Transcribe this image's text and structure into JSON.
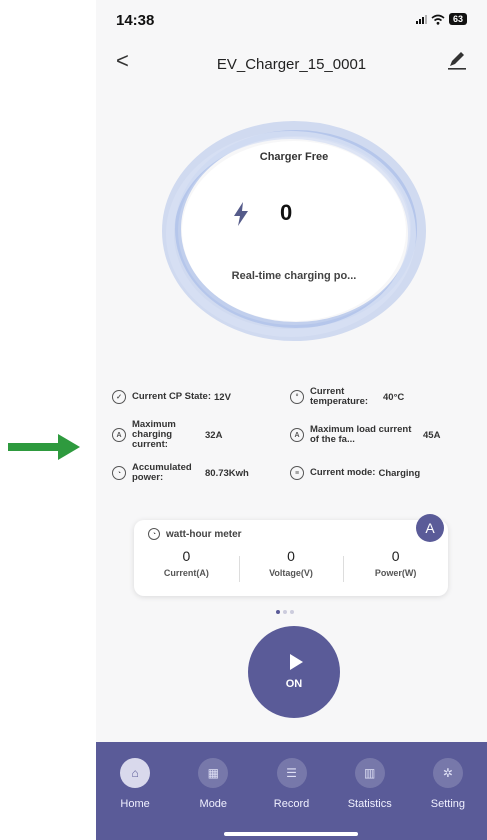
{
  "status": {
    "time": "14:38",
    "battery": "63"
  },
  "nav": {
    "back": "<",
    "title": "EV_Charger_15_0001"
  },
  "gauge": {
    "state": "Charger Free",
    "value": "0",
    "label": "Real-time charging po..."
  },
  "info": {
    "cp_label": "Current CP State:",
    "cp_value": "12V",
    "temp_label": "Current temperature:",
    "temp_value": "40°C",
    "max_current_label": "Maximum charging current:",
    "max_current_value": "32A",
    "max_load_label": "Maximum load current of the fa...",
    "max_load_value": "45A",
    "acc_power_label": "Accumulated power:",
    "acc_power_value": "80.73Kwh",
    "mode_label": "Current mode:",
    "mode_value": "Charging"
  },
  "meter": {
    "title": "watt-hour meter",
    "badge": "A",
    "current_value": "0",
    "current_unit": "Current(A)",
    "voltage_value": "0",
    "voltage_unit": "Voltage(V)",
    "power_value": "0",
    "power_unit": "Power(W)"
  },
  "action": {
    "label": "ON"
  },
  "tabs": [
    {
      "label": "Home",
      "icon": "home-icon"
    },
    {
      "label": "Mode",
      "icon": "grid-icon"
    },
    {
      "label": "Record",
      "icon": "document-icon"
    },
    {
      "label": "Statistics",
      "icon": "chart-icon"
    },
    {
      "label": "Setting",
      "icon": "gear-icon"
    }
  ],
  "colors": {
    "accent": "#5a5b98",
    "arrow": "#2e9a3e",
    "ring": "#b7c7ea"
  }
}
